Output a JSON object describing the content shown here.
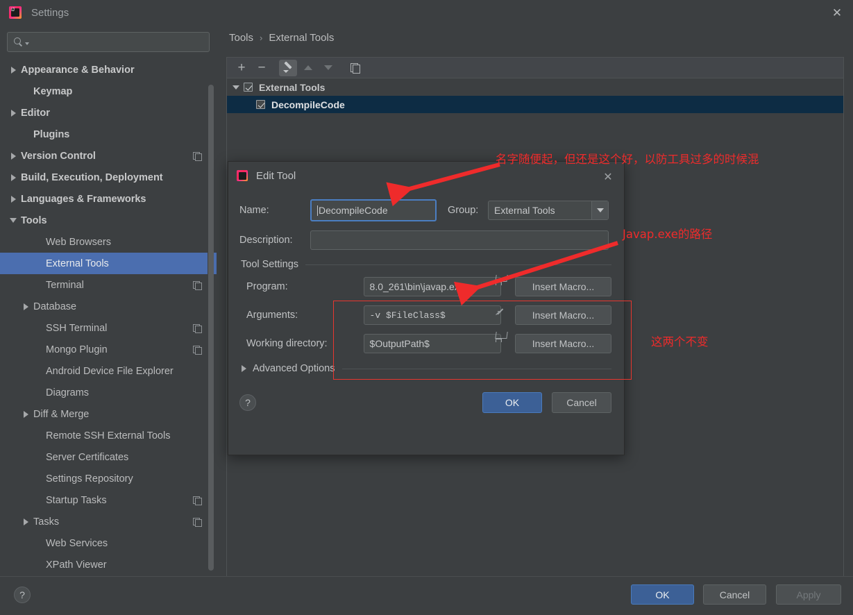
{
  "window": {
    "title": "Settings",
    "logo_icon": "intellij-idea-logo",
    "close_icon": "close-icon"
  },
  "search": {
    "value": "",
    "placeholder": "",
    "icon": "search-icon",
    "caret_icon": "chevron-down-icon"
  },
  "sidebar": {
    "items": [
      {
        "label": "Appearance & Behavior",
        "arrow": "right",
        "indent": 0,
        "bold": true,
        "badge": false,
        "selected": false
      },
      {
        "label": "Keymap",
        "arrow": "none",
        "indent": 1,
        "bold": true,
        "badge": false,
        "selected": false
      },
      {
        "label": "Editor",
        "arrow": "right",
        "indent": 0,
        "bold": true,
        "badge": false,
        "selected": false
      },
      {
        "label": "Plugins",
        "arrow": "none",
        "indent": 1,
        "bold": true,
        "badge": false,
        "selected": false
      },
      {
        "label": "Version Control",
        "arrow": "right",
        "indent": 0,
        "bold": true,
        "badge": true,
        "selected": false
      },
      {
        "label": "Build, Execution, Deployment",
        "arrow": "right",
        "indent": 0,
        "bold": true,
        "badge": false,
        "selected": false
      },
      {
        "label": "Languages & Frameworks",
        "arrow": "right",
        "indent": 0,
        "bold": true,
        "badge": false,
        "selected": false
      },
      {
        "label": "Tools",
        "arrow": "down",
        "indent": 0,
        "bold": true,
        "badge": false,
        "selected": false
      },
      {
        "label": "Web Browsers",
        "arrow": "none",
        "indent": 2,
        "bold": false,
        "badge": false,
        "selected": false
      },
      {
        "label": "External Tools",
        "arrow": "none",
        "indent": 2,
        "bold": false,
        "badge": false,
        "selected": true
      },
      {
        "label": "Terminal",
        "arrow": "none",
        "indent": 2,
        "bold": false,
        "badge": true,
        "selected": false
      },
      {
        "label": "Database",
        "arrow": "right",
        "indent": 1,
        "bold": false,
        "badge": false,
        "selected": false
      },
      {
        "label": "SSH Terminal",
        "arrow": "none",
        "indent": 2,
        "bold": false,
        "badge": true,
        "selected": false
      },
      {
        "label": "Mongo Plugin",
        "arrow": "none",
        "indent": 2,
        "bold": false,
        "badge": true,
        "selected": false
      },
      {
        "label": "Android Device File Explorer",
        "arrow": "none",
        "indent": 2,
        "bold": false,
        "badge": false,
        "selected": false
      },
      {
        "label": "Diagrams",
        "arrow": "none",
        "indent": 2,
        "bold": false,
        "badge": false,
        "selected": false
      },
      {
        "label": "Diff & Merge",
        "arrow": "right",
        "indent": 1,
        "bold": false,
        "badge": false,
        "selected": false
      },
      {
        "label": "Remote SSH External Tools",
        "arrow": "none",
        "indent": 2,
        "bold": false,
        "badge": false,
        "selected": false
      },
      {
        "label": "Server Certificates",
        "arrow": "none",
        "indent": 2,
        "bold": false,
        "badge": false,
        "selected": false
      },
      {
        "label": "Settings Repository",
        "arrow": "none",
        "indent": 2,
        "bold": false,
        "badge": false,
        "selected": false
      },
      {
        "label": "Startup Tasks",
        "arrow": "none",
        "indent": 2,
        "bold": false,
        "badge": true,
        "selected": false
      },
      {
        "label": "Tasks",
        "arrow": "right",
        "indent": 1,
        "bold": false,
        "badge": true,
        "selected": false
      },
      {
        "label": "Web Services",
        "arrow": "none",
        "indent": 2,
        "bold": false,
        "badge": false,
        "selected": false
      },
      {
        "label": "XPath Viewer",
        "arrow": "none",
        "indent": 2,
        "bold": false,
        "badge": false,
        "selected": false
      }
    ]
  },
  "breadcrumb": {
    "root": "Tools",
    "separator": "›",
    "leaf": "External Tools"
  },
  "panel": {
    "toolbar": [
      {
        "name": "add-button",
        "icon": "plus-icon",
        "active": false
      },
      {
        "name": "remove-button",
        "icon": "minus-icon",
        "active": false
      },
      {
        "name": "edit-button",
        "icon": "pencil-icon",
        "active": true
      },
      {
        "name": "move-up-button",
        "icon": "triangle-up-icon",
        "active": false
      },
      {
        "name": "move-down-button",
        "icon": "triangle-down-icon",
        "active": false
      },
      {
        "name": "copy-button",
        "icon": "copy-icon",
        "active": false
      }
    ],
    "tree": [
      {
        "label": "External Tools",
        "checked": true,
        "child": false,
        "selected": false,
        "expander": "down"
      },
      {
        "label": "DecompileCode",
        "checked": true,
        "child": true,
        "selected": true,
        "expander": "none"
      }
    ]
  },
  "dialog": {
    "title": "Edit Tool",
    "logo_icon": "intellij-idea-logo",
    "close_icon": "close-icon",
    "name_label": "Name:",
    "name_value": "DecompileCode",
    "group_label": "Group:",
    "group_value": "External Tools",
    "description_label": "Description:",
    "description_value": "",
    "tool_settings_label": "Tool Settings",
    "program_label": "Program:",
    "program_value": "8.0_261\\bin\\javap.exe",
    "arguments_label": "Arguments:",
    "arguments_value": "-v $FileClass$",
    "working_dir_label": "Working directory:",
    "working_dir_value": "$OutputPath$",
    "insert_macro_label": "Insert Macro...",
    "advanced_options_label": "Advanced Options",
    "help_label": "?",
    "ok_label": "OK",
    "cancel_label": "Cancel"
  },
  "bottom_bar": {
    "help_label": "?",
    "ok_label": "OK",
    "cancel_label": "Cancel",
    "apply_label": "Apply"
  },
  "annotations": {
    "color": "#ef2b2b",
    "note_name": "名字随便起，但还是这个好，以防工具过多的时候混",
    "note_program": "Javap.exe的路径",
    "note_unchanged": "这两个不变"
  }
}
